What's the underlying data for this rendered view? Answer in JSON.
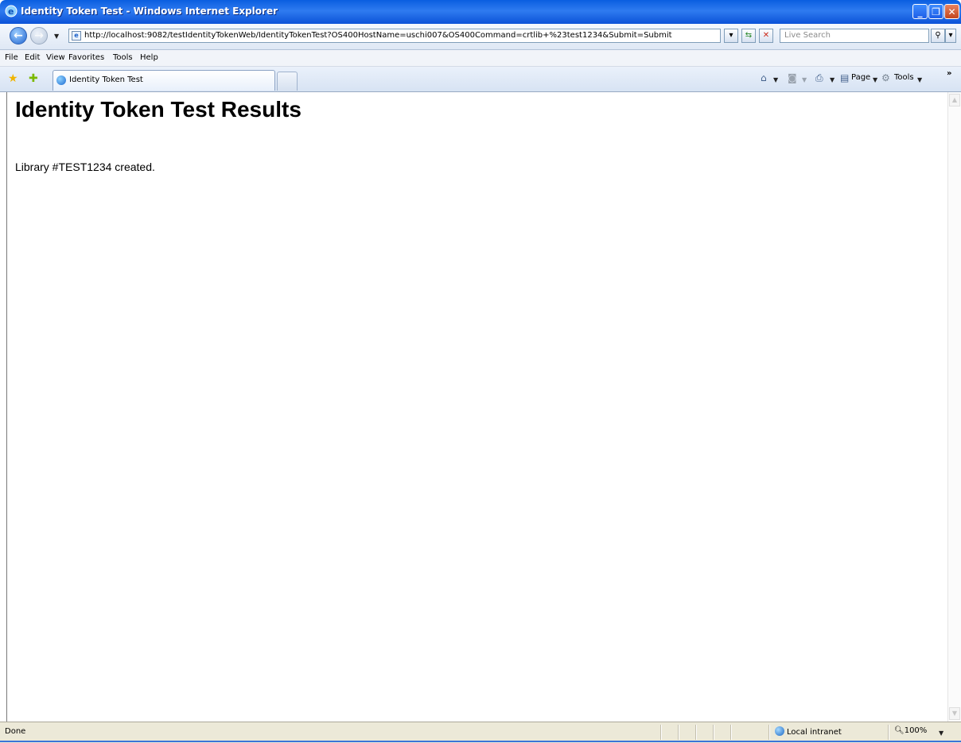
{
  "window": {
    "title": "Identity Token Test - Windows Internet Explorer",
    "title_color": "#0a5ee0"
  },
  "navbar": {
    "back_icon": "back-arrow-icon",
    "forward_icon": "forward-arrow-icon",
    "address": "http://localhost:9082/testIdentityTokenWeb/IdentityTokenTest?OS400HostName=uschi007&OS400Command=crtlib+%23test1234&Submit=Submit",
    "search_placeholder": "Live Search"
  },
  "menu": {
    "items": [
      "File",
      "Edit",
      "View",
      "Favorites",
      "Tools",
      "Help"
    ]
  },
  "tabs": {
    "items": [
      {
        "label": "Identity Token Test"
      }
    ]
  },
  "commandbar": {
    "page_label": "Page",
    "tools_label": "Tools"
  },
  "content": {
    "heading": "Identity Token Test Results",
    "message": "Library #TEST1234 created."
  },
  "statusbar": {
    "status": "Done",
    "zone": "Local intranet",
    "zoom": "100%"
  }
}
